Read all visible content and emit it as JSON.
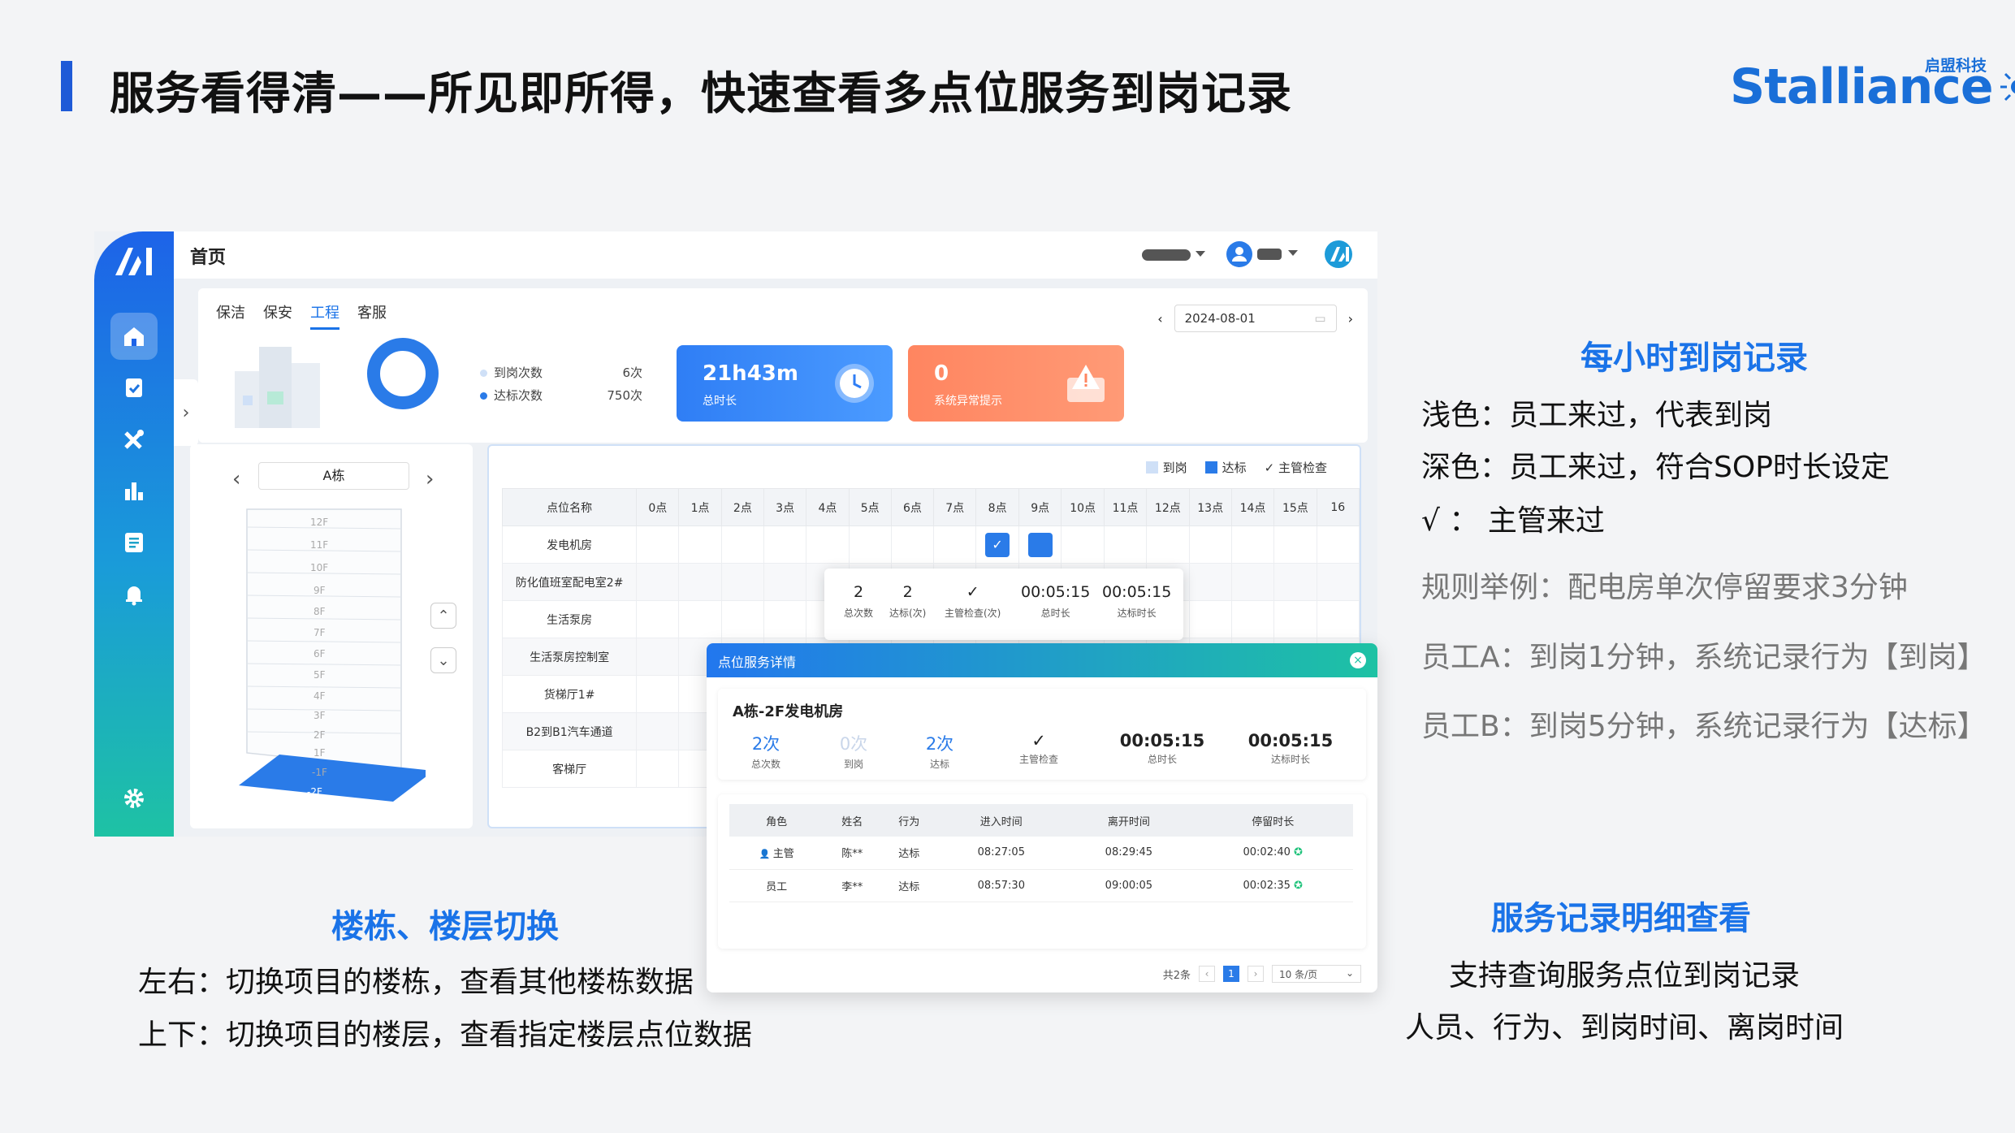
{
  "slide": {
    "title": "服务看得清——所见即所得，快速查看多点位服务到岗记录",
    "logo_text": "Stalliance",
    "logo_sub": "启盟科技"
  },
  "app": {
    "topbar_title": "首页",
    "tabs": [
      {
        "label": "保洁",
        "active": false
      },
      {
        "label": "保安",
        "active": false
      },
      {
        "label": "工程",
        "active": true
      },
      {
        "label": "客服",
        "active": false
      }
    ],
    "date": "2024-08-01",
    "stats": {
      "arrive_label": "到岗次数",
      "arrive_value": "6次",
      "qualified_label": "达标次数",
      "qualified_value": "750次"
    },
    "cards": {
      "duration_value": "21h43m",
      "duration_label": "总时长",
      "alert_value": "0",
      "alert_label": "系统异常提示"
    },
    "building": {
      "name": "A栋",
      "floors": [
        "12F",
        "11F",
        "10F",
        "9F",
        "8F",
        "7F",
        "6F",
        "5F",
        "4F",
        "3F",
        "2F",
        "1F",
        "-1F",
        "-2F"
      ],
      "selected_floor": "-2F"
    },
    "grid_legend": {
      "arrive": "到岗",
      "qualified": "达标",
      "supervisor": "主管检查"
    },
    "grid": {
      "header": "点位名称",
      "hours": [
        "0点",
        "1点",
        "2点",
        "3点",
        "4点",
        "5点",
        "6点",
        "7点",
        "8点",
        "9点",
        "10点",
        "11点",
        "12点",
        "13点",
        "14点",
        "15点",
        "16"
      ],
      "rows": [
        "发电机房",
        "防化值班室配电室2#",
        "生活泵房",
        "生活泵房控制室",
        "货梯厅1#",
        "B2到B1汽车通道",
        "客梯厅"
      ]
    },
    "tooltip": {
      "items": [
        {
          "value": "2",
          "label": "总次数"
        },
        {
          "value": "2",
          "label": "达标(次)"
        },
        {
          "value": "✓",
          "label": "主管检查(次)"
        },
        {
          "value": "00:05:15",
          "label": "总时长"
        },
        {
          "value": "00:05:15",
          "label": "达标时长"
        }
      ]
    },
    "dialog": {
      "title": "点位服务详情",
      "location": "A栋-2F发电机房",
      "summary": [
        {
          "value": "2次",
          "label": "总次数"
        },
        {
          "value": "0次",
          "label": "到岗"
        },
        {
          "value": "2次",
          "label": "达标"
        },
        {
          "value": "✓",
          "label": "主管检查"
        },
        {
          "value": "00:05:15",
          "label": "总时长"
        },
        {
          "value": "00:05:15",
          "label": "达标时长"
        }
      ],
      "columns": [
        "角色",
        "姓名",
        "行为",
        "进入时间",
        "离开时间",
        "停留时长"
      ],
      "rows": [
        [
          "主管",
          "陈**",
          "达标",
          "08:27:05",
          "08:29:45",
          "00:02:40"
        ],
        [
          "员工",
          "李**",
          "达标",
          "08:57:30",
          "09:00:05",
          "00:02:35"
        ]
      ],
      "total": "共2条",
      "page": "1",
      "page_size": "10 条/页"
    }
  },
  "annotations": {
    "hourly": {
      "head": "每小时到岗记录",
      "line1": "浅色：员工来过，代表到岗",
      "line2": "深色：员工来过，符合SOP时长设定",
      "line3": "√    ：  主管来过",
      "rule": "规则举例：配电房单次停留要求3分钟",
      "staff_a": "员工A：到岗1分钟，系统记录行为【到岗】",
      "staff_b": "员工B：到岗5分钟，系统记录行为【达标】"
    },
    "building": {
      "head": "楼栋、楼层切换",
      "line1": "左右：切换项目的楼栋，查看其他楼栋数据",
      "line2": "上下：切换项目的楼层，查看指定楼层点位数据"
    },
    "detail": {
      "head": "服务记录明细查看",
      "line1": "支持查询服务点位到岗记录",
      "line2": "人员、行为、到岗时间、离岗时间"
    }
  },
  "colors": {
    "accent": "#1a73e8",
    "light_mark": "#cfe0f7",
    "dark_mark": "#2a7be8",
    "alert": "#ff8a65"
  }
}
